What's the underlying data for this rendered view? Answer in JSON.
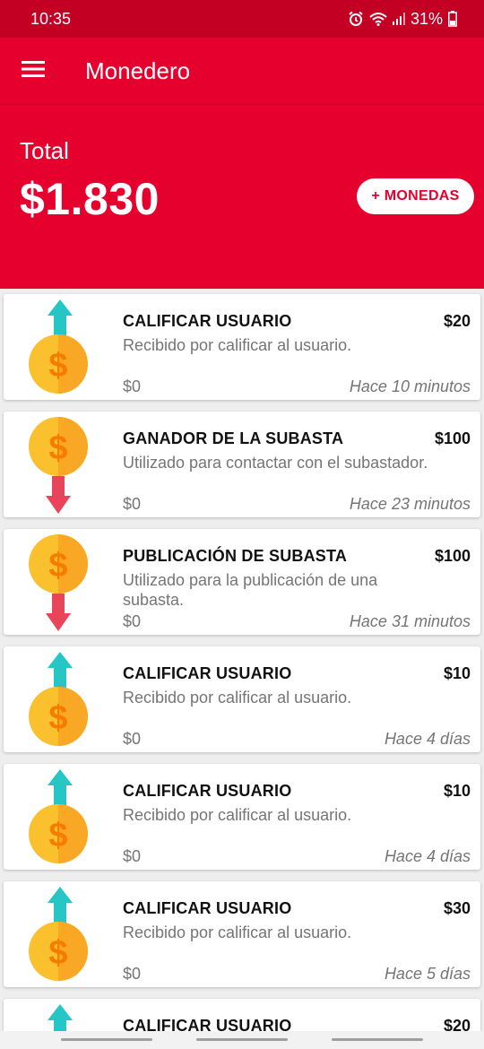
{
  "status_bar": {
    "time": "10:35",
    "battery": "31%"
  },
  "app_bar": {
    "title": "Monedero",
    "menu_icon": "hamburger-menu-icon"
  },
  "header": {
    "total_label": "Total",
    "total_amount": "$1.830",
    "add_button_label": "+ MONEDAS"
  },
  "transactions": [
    {
      "direction": "up",
      "title": "CALIFICAR USUARIO",
      "amount": "$20",
      "description": "Recibido por calificar al usuario.",
      "balance": "$0",
      "time": "Hace 10 minutos"
    },
    {
      "direction": "down",
      "title": "GANADOR DE LA SUBASTA",
      "amount": "$100",
      "description": "Utilizado para contactar con el subastador.",
      "balance": "$0",
      "time": "Hace 23 minutos"
    },
    {
      "direction": "down",
      "title": "PUBLICACIÓN DE SUBASTA",
      "amount": "$100",
      "description": "Utilizado para la publicación de una subasta.",
      "balance": "$0",
      "time": "Hace 31 minutos"
    },
    {
      "direction": "up",
      "title": "CALIFICAR USUARIO",
      "amount": "$10",
      "description": "Recibido por calificar al usuario.",
      "balance": "$0",
      "time": "Hace 4 días"
    },
    {
      "direction": "up",
      "title": "CALIFICAR USUARIO",
      "amount": "$10",
      "description": "Recibido por calificar al usuario.",
      "balance": "$0",
      "time": "Hace 4 días"
    },
    {
      "direction": "up",
      "title": "CALIFICAR USUARIO",
      "amount": "$30",
      "description": "Recibido por calificar al usuario.",
      "balance": "$0",
      "time": "Hace 5 días"
    },
    {
      "direction": "up",
      "title": "CALIFICAR USUARIO",
      "amount": "$20",
      "description": "",
      "balance": "",
      "time": ""
    }
  ],
  "colors": {
    "primary": "#e6002d",
    "status_bar": "#c30024",
    "coin": "#fbc02d",
    "arrow_up": "#26c6c6",
    "arrow_down": "#e8445a"
  }
}
